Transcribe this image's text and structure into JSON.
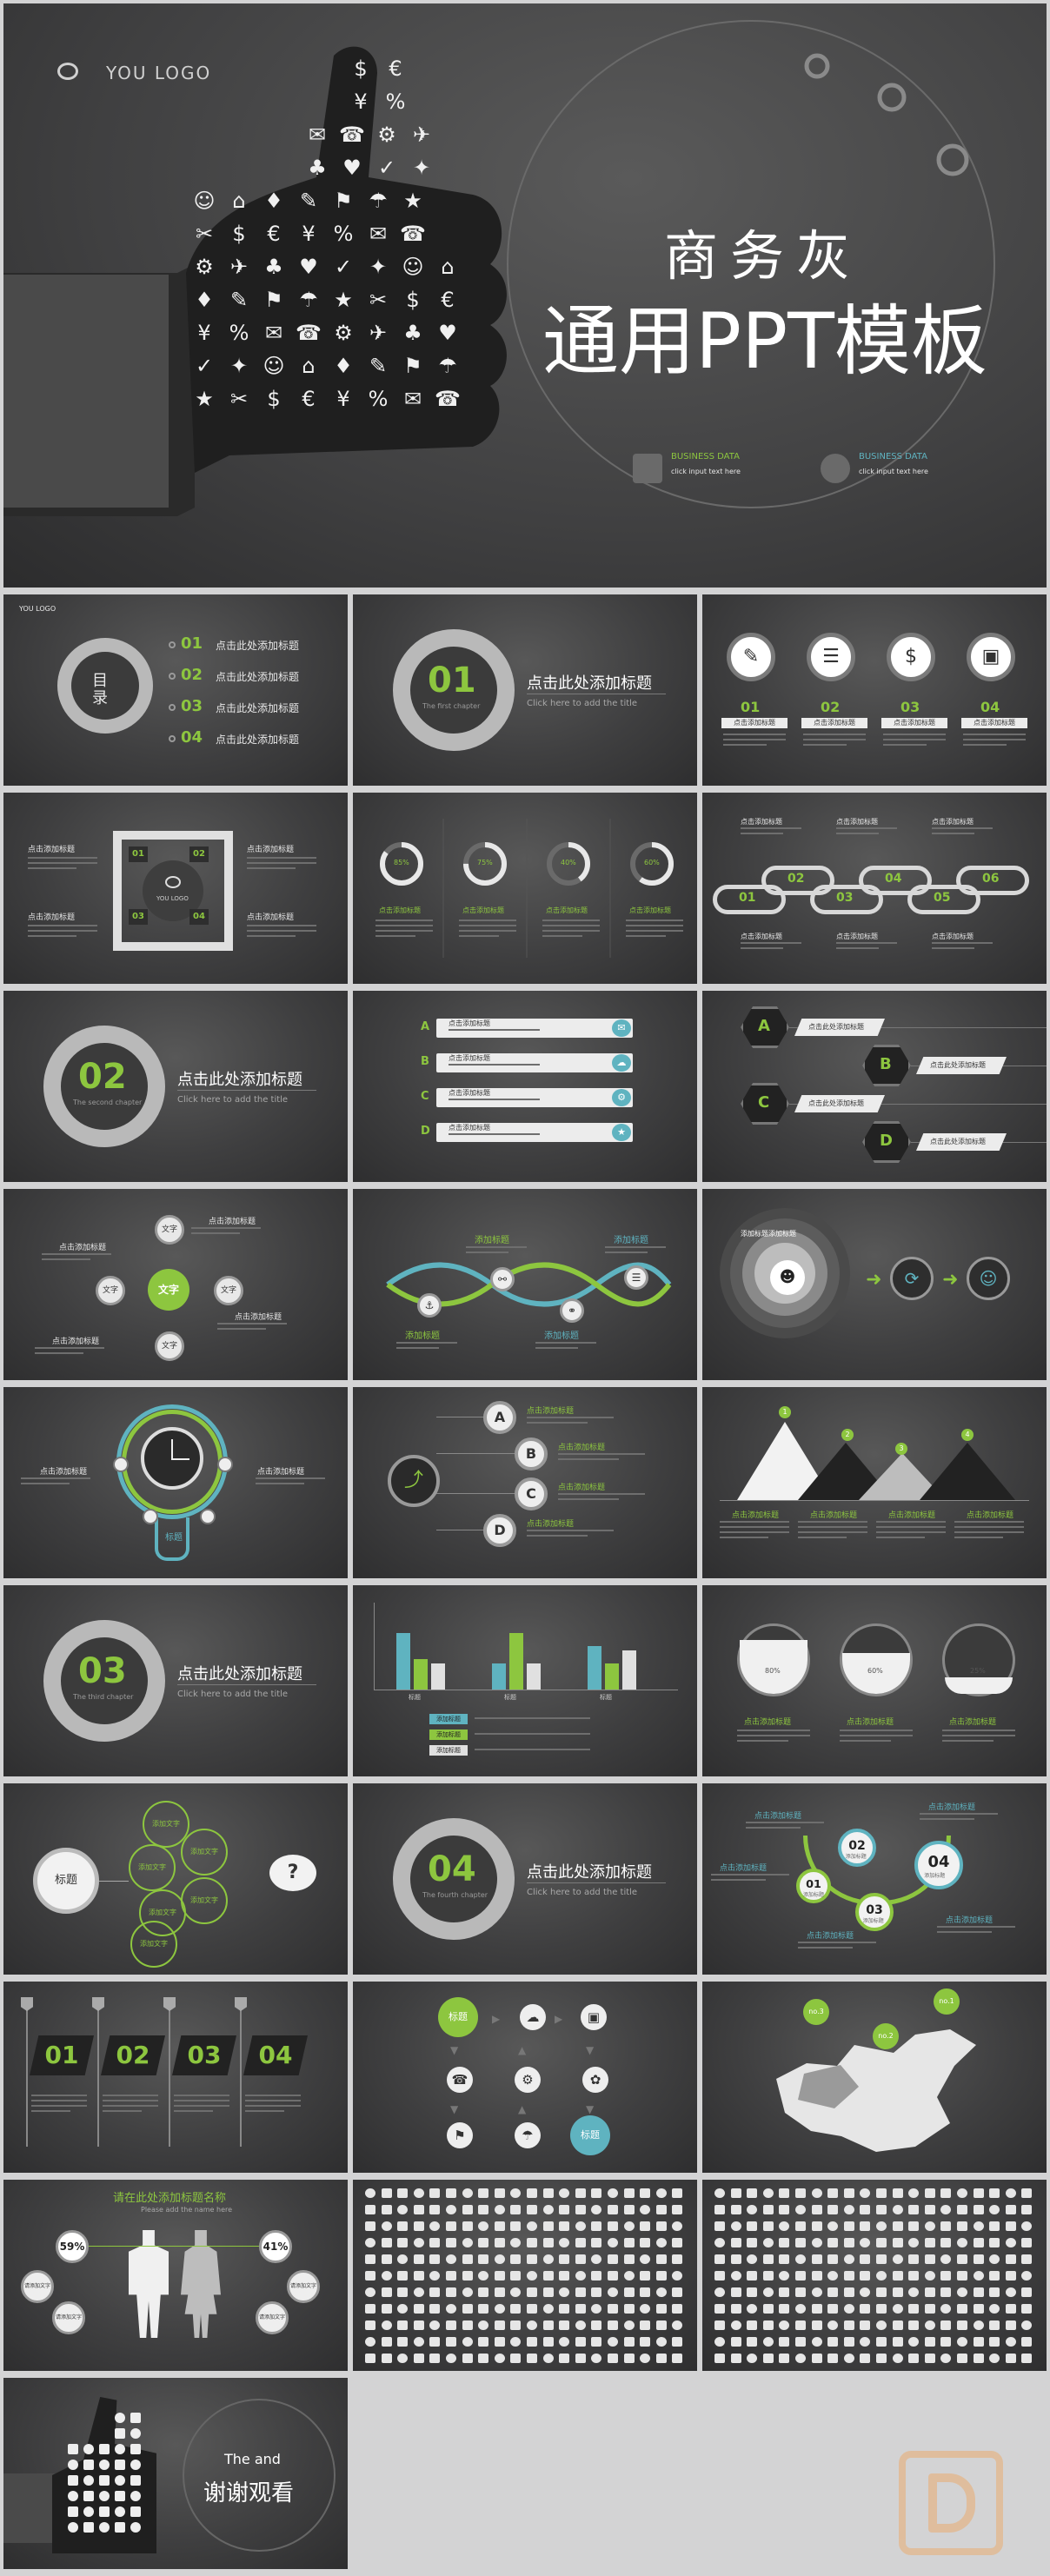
{
  "cover": {
    "logo_text": "YOU  LOGO",
    "title_line1": "商务灰",
    "title_line2": "通用PPT模板",
    "biz1_title": "BUSINESS DATA",
    "biz2_title": "BUSINESS DATA",
    "biz_sub": "click input text here"
  },
  "toc": {
    "title": "目录",
    "items": [
      {
        "num": "01",
        "label": "点击此处添加标题"
      },
      {
        "num": "02",
        "label": "点击此处添加标题"
      },
      {
        "num": "03",
        "label": "点击此处添加标题"
      },
      {
        "num": "04",
        "label": "点击此处添加标题"
      }
    ],
    "logo_small": "YOU LOGO"
  },
  "chapters": [
    {
      "num": "01",
      "sub": "The first chapter",
      "title": "点击此处添加标题",
      "subtitle": "Click here to add the title"
    },
    {
      "num": "02",
      "sub": "The second chapter",
      "title": "点击此处添加标题",
      "subtitle": "Click here to add the title"
    },
    {
      "num": "03",
      "sub": "The third chapter",
      "title": "点击此处添加标题",
      "subtitle": "Click here to add the title"
    },
    {
      "num": "04",
      "sub": "The fourth chapter",
      "title": "点击此处添加标题",
      "subtitle": "Click here to add the title"
    }
  ],
  "four_icons": {
    "nums": [
      "01",
      "02",
      "03",
      "04"
    ],
    "label": "点击添加标题"
  },
  "quad": {
    "nums": [
      "01",
      "02",
      "03",
      "04"
    ],
    "label": "点击添加标题",
    "logo": "YOU LOGO"
  },
  "donuts": {
    "values": [
      "85%",
      "75%",
      "40%",
      "60%"
    ],
    "fractions": [
      0.85,
      0.75,
      0.4,
      0.6
    ],
    "label": "点击添加标题"
  },
  "chain": {
    "nums": [
      "01",
      "02",
      "03",
      "04",
      "05",
      "06"
    ],
    "label": "点击添加标题"
  },
  "abcd_list": {
    "letters": [
      "A",
      "B",
      "C",
      "D"
    ],
    "label": "点击添加标题"
  },
  "hex": {
    "letters": [
      "A",
      "B",
      "C",
      "D"
    ],
    "label": "点击此处添加标题"
  },
  "center_hub": {
    "center": "文字",
    "nodes": [
      "文字",
      "文字",
      "文字",
      "文字"
    ],
    "label": "点击添加标题"
  },
  "wave": {
    "labels": [
      "添加标题",
      "添加标题",
      "添加标题",
      "添加标题"
    ]
  },
  "funnel": {
    "label": "添加标题添加标题"
  },
  "bulb": {
    "caption": "标题",
    "label": "点击添加标题"
  },
  "abcd_circles": {
    "letters": [
      "A",
      "B",
      "C",
      "D"
    ],
    "label": "点击添加标题"
  },
  "mountains": {
    "nums": [
      "1",
      "2",
      "3",
      "4"
    ],
    "label": "点击添加标题"
  },
  "bar_chart": {
    "legend": [
      "添加标题",
      "添加标题",
      "添加标题"
    ],
    "group_label": "标题",
    "series_colors": [
      "#5fb3c0",
      "#8dc63f",
      "#e0e0e0"
    ]
  },
  "bowls": {
    "values": [
      "80%",
      "60%",
      "25%"
    ],
    "fractions": [
      0.8,
      0.6,
      0.25
    ],
    "label": "点击添加标题"
  },
  "bubbles": {
    "main": "标题",
    "labels": [
      "添加文字",
      "添加文字",
      "添加文字",
      "添加文字",
      "添加文字",
      "添加文字"
    ],
    "question": "?"
  },
  "steps": {
    "nums": [
      "01",
      "02",
      "03",
      "04"
    ],
    "label": "添加标题",
    "title": "点击添加标题"
  },
  "parallelograms": {
    "nums": [
      "01",
      "02",
      "03",
      "04"
    ]
  },
  "flow_icons": {
    "start": "标题",
    "end": "标题"
  },
  "map": {
    "labels": [
      "no.3",
      "no.2",
      "no.1"
    ]
  },
  "people": {
    "title": "请在此处添加标题名称",
    "subtitle": "Please add the name here",
    "left": "59%",
    "right": "41%",
    "bubble": "请添加文字"
  },
  "end": {
    "line1": "The and",
    "line2": "谢谢观看"
  }
}
